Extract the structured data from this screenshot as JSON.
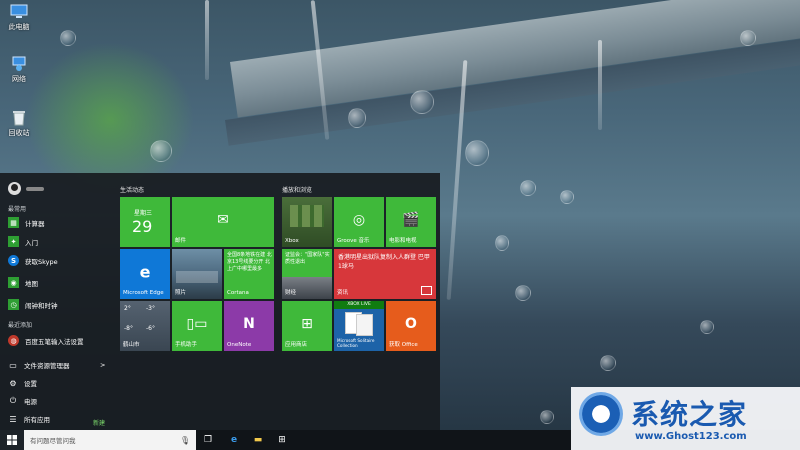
{
  "desktop": {
    "icons": [
      {
        "label": "此电脑",
        "icon": "computer-icon"
      },
      {
        "label": "网络",
        "icon": "network-icon"
      },
      {
        "label": "回收站",
        "icon": "recycle-bin-icon"
      }
    ]
  },
  "start_menu": {
    "left": {
      "most_used_label": "最常用",
      "most_used": [
        {
          "label": "计算器",
          "icon": "calculator-icon",
          "color": "#2e9e33"
        },
        {
          "label": "入门",
          "icon": "lightbulb-icon",
          "color": "#2e9e33"
        },
        {
          "label": "获取Skype",
          "icon": "skype-icon",
          "color": "#0f78d7"
        },
        {
          "label": "地图",
          "icon": "maps-icon",
          "color": "#2e9e33"
        },
        {
          "label": "闹钟和时钟",
          "icon": "alarm-icon",
          "color": "#2e9e33"
        }
      ],
      "recent_label": "最近添加",
      "recent": [
        {
          "label": "百度五笔输入法设置",
          "icon": "baidu-ime-icon",
          "color": "#c0392b"
        }
      ],
      "system": [
        {
          "label": "文件资源管理器",
          "icon": "folder-icon",
          "chevron": ">"
        },
        {
          "label": "设置",
          "icon": "gear-icon"
        },
        {
          "label": "电源",
          "icon": "power-icon"
        },
        {
          "label": "所有应用",
          "icon": "list-icon"
        }
      ],
      "new_badge": "新建"
    },
    "groups": [
      {
        "title": "生活动态"
      },
      {
        "title": "播放和浏览"
      }
    ],
    "tiles": {
      "calendar": {
        "day": "星期三",
        "date": "29"
      },
      "mail": {
        "label": "邮件"
      },
      "edge": {
        "label": "Microsoft Edge"
      },
      "photos": {
        "label": "照片"
      },
      "cortana": {
        "headline": "全国8条地铁在建 北京13号线要分开 北上广中哪里最多",
        "label": "Cortana"
      },
      "weather": {
        "temps": [
          "2°",
          "-3°",
          "-8°",
          "-6°"
        ],
        "label": "鹤山市"
      },
      "phone": {
        "label": "手机助手"
      },
      "onenote": {
        "label": "OneNote"
      },
      "xbox": {
        "label": "Xbox"
      },
      "groove": {
        "label": "Groove 音乐"
      },
      "movies": {
        "label": "电影和电视"
      },
      "finance": {
        "headline": "证监会：\"国家队\"实质性退出",
        "label": "财经"
      },
      "news": {
        "headline": "香港明星出狱队复制入人群登 巴甲1球马",
        "label": "资讯"
      },
      "store": {
        "label": "应用商店"
      },
      "solitaire": {
        "badge": "XBOX LIVE",
        "label": "Microsoft Solitaire Collection"
      },
      "office": {
        "label": "获取 Office"
      }
    }
  },
  "taskbar": {
    "search_placeholder": "有问题尽管问我"
  },
  "watermark": {
    "title": "系统之家",
    "url": "www.Ghost123.com"
  },
  "colors": {
    "tile_green": "#3fb93a",
    "tile_blue": "#0f78d7",
    "tile_purple": "#8c3aa8",
    "tile_red": "#d7373b",
    "tile_orange": "#e65c1c",
    "start_bg": "#181c20"
  }
}
